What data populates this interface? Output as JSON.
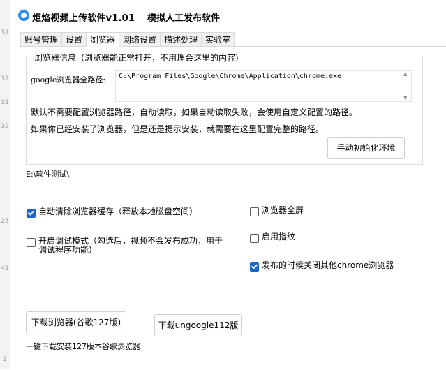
{
  "gutter": {
    "numbers": [
      "37",
      "32",
      "32",
      "32",
      "25",
      "42",
      "1"
    ]
  },
  "window": {
    "title": "炬焰视频上传软件v1.01",
    "subtitle": "模拟人工发布软件"
  },
  "tabs": [
    {
      "label": "账号管理"
    },
    {
      "label": "设置"
    },
    {
      "label": "浏览器"
    },
    {
      "label": "网络设置"
    },
    {
      "label": "描述处理"
    },
    {
      "label": "实验室"
    }
  ],
  "active_tab": "浏览器",
  "browser_group": {
    "legend": "浏览器信息（浏览器能正常打开，不用理会这里的内容）",
    "path_label": "google浏览器全路径:",
    "path_value": "C:\\Program Files\\Google\\Chrome\\Application\\chrome.exe",
    "note1": "默认不需要配置浏览器路径，自动读取，如果自动读取失败，会使用自定义配置的路径。",
    "note2": "如果你已经安装了浏览器，但是还是提示安装，就需要在这里配置完整的路径。",
    "init_button": "手动初始化环境"
  },
  "path_text": "E:\\软件测试\\",
  "options": {
    "clear_cache": {
      "label": "自动清除浏览器缓存（释放本地磁盘空间）",
      "checked": true
    },
    "debug_mode": {
      "label": "开启调试模式（勾选后，视频不会发布成功，用于调试程序功能）",
      "checked": false
    },
    "fullscreen": {
      "label": "浏览器全屏",
      "checked": false
    },
    "fingerprint": {
      "label": "启用指纹",
      "checked": false
    },
    "close_others": {
      "label": "发布的时候关闭其他chrome浏览器",
      "checked": true
    }
  },
  "downloads": {
    "chrome_button": "下载浏览器(谷歌127版)",
    "ungoogle_button": "下载ungoogle112版",
    "hint": "一键下载安装127版本谷歌浏览器"
  },
  "colors": {
    "checkbox_checked": "#1867c8",
    "app_icon": "#2d8de8"
  }
}
